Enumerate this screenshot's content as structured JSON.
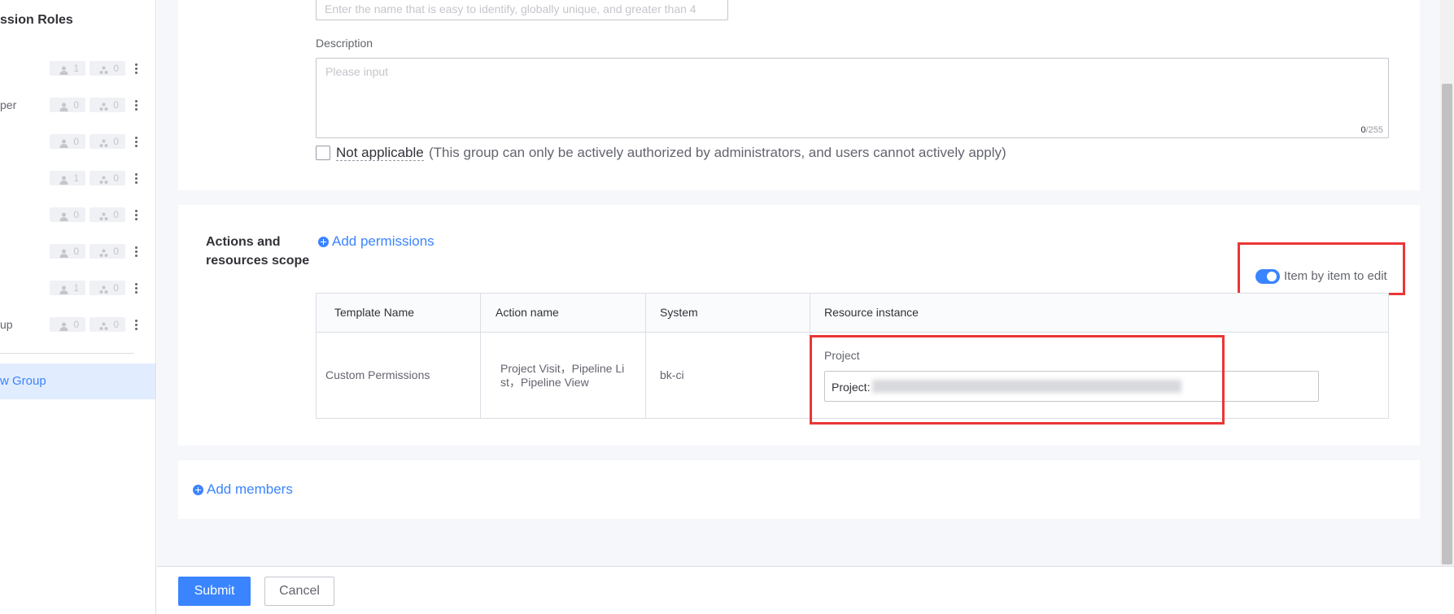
{
  "sidebar": {
    "title": "ssion Roles",
    "roles": [
      {
        "label": "",
        "users": "1",
        "groups": "0"
      },
      {
        "label": "per",
        "users": "0",
        "groups": "0"
      },
      {
        "label": "",
        "users": "0",
        "groups": "0"
      },
      {
        "label": "",
        "users": "1",
        "groups": "0"
      },
      {
        "label": "",
        "users": "0",
        "groups": "0"
      },
      {
        "label": "",
        "users": "0",
        "groups": "0"
      },
      {
        "label": "",
        "users": "1",
        "groups": "0"
      },
      {
        "label": "up",
        "users": "0",
        "groups": "0"
      }
    ],
    "new_group_label": "w Group"
  },
  "form": {
    "name_placeholder": "Enter the name that is easy to identify, globally unique, and greater than 4",
    "description_label": "Description",
    "description_placeholder": "Please input",
    "description_count": "0",
    "description_max": "/255",
    "not_applicable_label": "Not applicable",
    "not_applicable_note": "(This group can only be actively authorized by administrators, and users cannot actively apply)"
  },
  "permissions": {
    "section_title_line1": "Actions and",
    "section_title_line2": "resources scope",
    "add_permissions_label": "Add permissions",
    "toggle_label": "Item by item to edit",
    "toggle_on": true,
    "table": {
      "headers": [
        "Template Name",
        "Action name",
        "System",
        "Resource instance"
      ],
      "rows": [
        {
          "template_name": "Custom Permissions",
          "action_name_line1": "Project Visit，Pipeline Li",
          "action_name_line2": "st，Pipeline View",
          "system": "bk-ci",
          "resource_label": "Project",
          "resource_value": "Project:"
        }
      ]
    }
  },
  "members": {
    "add_members_label": "Add members"
  },
  "footer": {
    "submit_label": "Submit",
    "cancel_label": "Cancel"
  },
  "colors": {
    "primary": "#3a84ff",
    "highlight_box": "#ea3636"
  }
}
